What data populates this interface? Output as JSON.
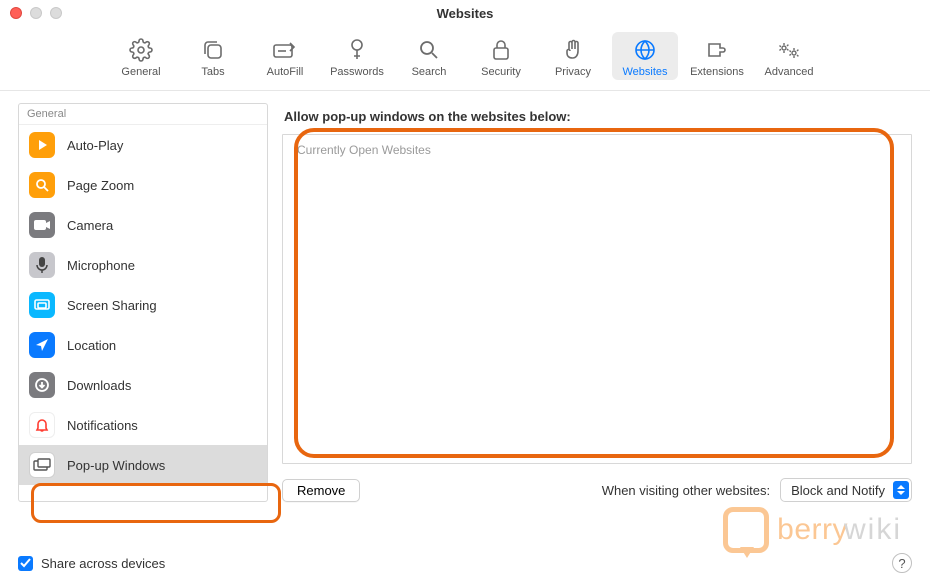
{
  "window": {
    "title": "Websites"
  },
  "toolbar": [
    {
      "id": "general",
      "label": "General"
    },
    {
      "id": "tabs",
      "label": "Tabs"
    },
    {
      "id": "autofill",
      "label": "AutoFill"
    },
    {
      "id": "passwords",
      "label": "Passwords"
    },
    {
      "id": "search",
      "label": "Search"
    },
    {
      "id": "security",
      "label": "Security"
    },
    {
      "id": "privacy",
      "label": "Privacy"
    },
    {
      "id": "websites",
      "label": "Websites",
      "active": true
    },
    {
      "id": "extensions",
      "label": "Extensions"
    },
    {
      "id": "advanced",
      "label": "Advanced"
    }
  ],
  "sidebar": {
    "header": "General",
    "items": [
      {
        "id": "autoplay",
        "label": "Auto-Play"
      },
      {
        "id": "pagezoom",
        "label": "Page Zoom"
      },
      {
        "id": "camera",
        "label": "Camera"
      },
      {
        "id": "microphone",
        "label": "Microphone"
      },
      {
        "id": "screenshare",
        "label": "Screen Sharing"
      },
      {
        "id": "location",
        "label": "Location"
      },
      {
        "id": "downloads",
        "label": "Downloads"
      },
      {
        "id": "notifications",
        "label": "Notifications"
      },
      {
        "id": "popup",
        "label": "Pop-up Windows",
        "selected": true
      }
    ]
  },
  "main": {
    "heading": "Allow pop-up windows on the websites below:",
    "list_header": "Currently Open Websites",
    "remove_label": "Remove",
    "other_label": "When visiting other websites:",
    "select_value": "Block and Notify"
  },
  "bottom": {
    "share_label": "Share across devices",
    "share_checked": true
  },
  "watermark": {
    "a": "berry",
    "b": "wiki"
  }
}
